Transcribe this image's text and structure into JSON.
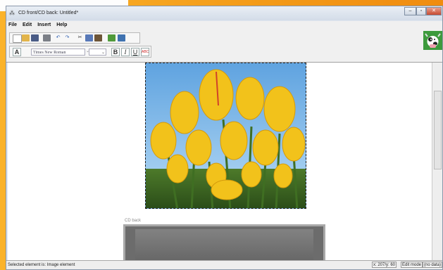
{
  "window": {
    "title": "CD front/CD back: Untitled*",
    "controls": [
      "minimize",
      "maximize",
      "close"
    ]
  },
  "menu": [
    "File",
    "Edit",
    "Insert",
    "Help"
  ],
  "toolbar": {
    "font_name": "Times New Roman",
    "font_size": "",
    "bold": "B",
    "italic": "I",
    "underline": "U",
    "text_style": "A",
    "spell": "ABC"
  },
  "icons": [
    "new-icon",
    "open-icon",
    "save-icon",
    "print-icon",
    "undo-icon",
    "redo-icon",
    "cut-icon",
    "copy-icon",
    "paste-icon",
    "image-icon",
    "gallery-icon"
  ],
  "workspace": {
    "front_image": "yellow tulips",
    "back_label": "CD back"
  },
  "status": {
    "selected": "Selected element is: Image element",
    "coords": "x: 207/y: 60",
    "mode": "Edit mode",
    "data": "(no data)"
  }
}
